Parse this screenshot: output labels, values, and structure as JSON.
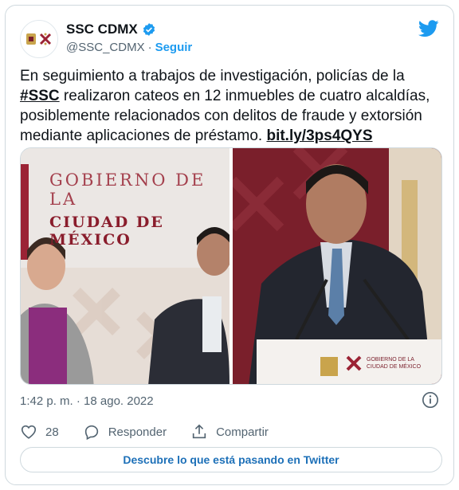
{
  "author": {
    "display_name": "SSC CDMX",
    "handle": "@SSC_CDMX",
    "separator": "·",
    "follow_label": "Seguir",
    "verified_icon": "verified-badge-icon"
  },
  "tweet": {
    "text_part1": "En seguimiento a trabajos de investigación, policías de la ",
    "hashtag": "#SSC",
    "text_part2": " realizaron cateos en 12 inmuebles de cuatro alcaldías, posiblemente relacionados con delitos de fraude y extorsión mediante aplicaciones de préstamo. ",
    "link": "bit.ly/3ps4QYS"
  },
  "media": {
    "left_banner_line1": "GOBIERNO DE LA",
    "left_banner_line2": "CIUDAD DE MÉXICO",
    "podium_line1": "GOBIERNO DE LA",
    "podium_line2": "CIUDAD DE MÉXICO"
  },
  "footer": {
    "timestamp": "1:42 p. m. · 18 ago. 2022",
    "likes_count": "28",
    "reply_label": "Responder",
    "share_label": "Compartir",
    "cta_label": "Descubre lo que está pasando en Twitter"
  },
  "colors": {
    "brand_blue": "#1d9bf0",
    "link_blue": "#1d70b8",
    "secondary_text": "#536471",
    "border": "#cfd9de",
    "government_maroon": "#9b2335"
  }
}
